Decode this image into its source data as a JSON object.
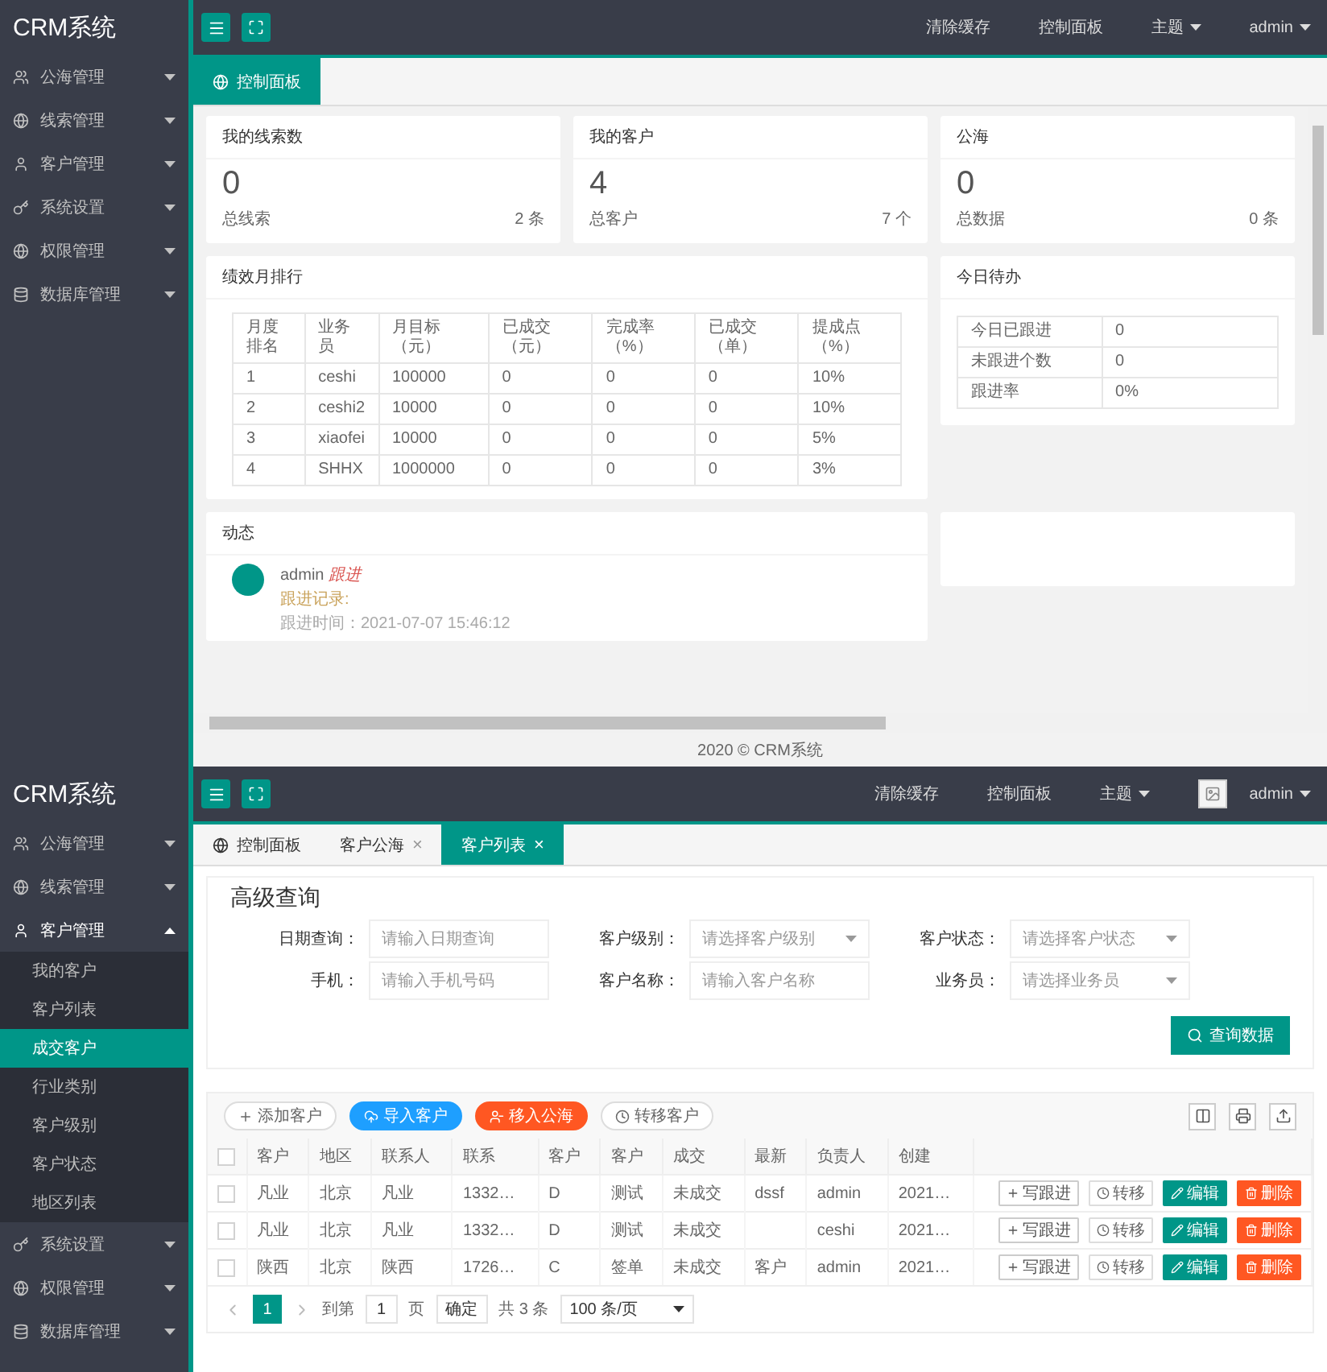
{
  "screens": [
    {
      "header": {
        "logo": "CRM系统",
        "links": [
          {
            "label": "清除缓存",
            "dropdown": false,
            "avatar": false
          },
          {
            "label": "控制面板",
            "dropdown": false,
            "avatar": false
          },
          {
            "label": "主题",
            "dropdown": true,
            "avatar": false
          },
          {
            "label": "admin",
            "dropdown": true,
            "avatar": false
          }
        ]
      },
      "sidebar": [
        {
          "label": "公海管理",
          "expanded": false
        },
        {
          "label": "线索管理",
          "expanded": false
        },
        {
          "label": "客户管理",
          "expanded": false
        },
        {
          "label": "系统设置",
          "expanded": false
        },
        {
          "label": "权限管理",
          "expanded": false
        },
        {
          "label": "数据库管理",
          "expanded": false
        }
      ],
      "tabs": [
        {
          "kind": "home",
          "label": "控制面板",
          "selected": true
        }
      ],
      "stat_cards": [
        {
          "title": "我的线索数",
          "value": "0",
          "footer_label": "总线索",
          "footer_count": "2 条"
        },
        {
          "title": "我的客户",
          "value": "4",
          "footer_label": "总客户",
          "footer_count": "7 个"
        },
        {
          "title": "公海",
          "value": "0",
          "footer_label": "总数据",
          "footer_count": "0 条"
        }
      ],
      "ranking": {
        "title": "绩效月排行",
        "columns": [
          "月度排名",
          "业务员",
          "月目标（元）",
          "已成交（元）",
          "完成率（%）",
          "已成交（单）",
          "提成点（%）"
        ],
        "rows": [
          [
            "1",
            "ceshi",
            "100000",
            "0",
            "0",
            "0",
            "10%"
          ],
          [
            "2",
            "ceshi2",
            "10000",
            "0",
            "0",
            "0",
            "10%"
          ],
          [
            "3",
            "xiaofei",
            "10000",
            "0",
            "0",
            "0",
            "5%"
          ],
          [
            "4",
            "SHHX",
            "1000000",
            "0",
            "0",
            "0",
            "3%"
          ]
        ]
      },
      "todo": {
        "title": "今日待办",
        "rows": [
          [
            "今日已跟进",
            "0"
          ],
          [
            "未跟进个数",
            "0"
          ],
          [
            "跟进率",
            "0%"
          ]
        ]
      },
      "activity": {
        "title": "动态",
        "items": [
          {
            "user": "admin",
            "action": "跟进",
            "note": "跟进记录:",
            "time": "跟进时间：2021-07-07 15:46:12"
          }
        ]
      },
      "footer": "2020 ©  CRM系统"
    },
    {
      "header": {
        "logo": "CRM系统",
        "links": [
          {
            "label": "清除缓存",
            "dropdown": false,
            "avatar": false
          },
          {
            "label": "控制面板",
            "dropdown": false,
            "avatar": false
          },
          {
            "label": "主题",
            "dropdown": true,
            "avatar": false
          },
          {
            "label": "admin",
            "dropdown": true,
            "avatar": true
          }
        ]
      },
      "sidebar": [
        {
          "label": "公海管理",
          "expanded": false
        },
        {
          "label": "线索管理",
          "expanded": false
        },
        {
          "label": "客户管理",
          "expanded": true,
          "children": [
            {
              "label": "我的客户",
              "selected": false
            },
            {
              "label": "客户列表",
              "selected": false
            },
            {
              "label": "成交客户",
              "selected": true
            },
            {
              "label": "行业类别",
              "selected": false
            },
            {
              "label": "客户级别",
              "selected": false
            },
            {
              "label": "客户状态",
              "selected": false
            },
            {
              "label": "地区列表",
              "selected": false
            }
          ]
        },
        {
          "label": "系统设置",
          "expanded": false
        },
        {
          "label": "权限管理",
          "expanded": false
        },
        {
          "label": "数据库管理",
          "expanded": false
        }
      ],
      "tabs": [
        {
          "kind": "home",
          "label": "控制面板",
          "selected": false
        },
        {
          "kind": "page",
          "label": "客户公海",
          "close": "×",
          "selected": false
        },
        {
          "kind": "page",
          "label": "客户列表",
          "close": "×",
          "selected": true
        }
      ],
      "search": {
        "title": "高级查询",
        "fields": [
          {
            "kind": "input",
            "label": "日期查询：",
            "placeholder": "请输入日期查询"
          },
          {
            "kind": "select",
            "label": "客户级别：",
            "placeholder": "请选择客户级别"
          },
          {
            "kind": "select",
            "label": "客户状态：",
            "placeholder": "请选择客户状态"
          },
          {
            "kind": "input",
            "label": "手机：",
            "placeholder": "请输入手机号码"
          },
          {
            "kind": "input",
            "label": "客户名称：",
            "placeholder": "请输入客户名称"
          },
          {
            "kind": "select",
            "label": "业务员：",
            "placeholder": "请选择业务员"
          }
        ],
        "button": "查询数据"
      },
      "toolbar": [
        {
          "kind": "add",
          "label": "添加客户"
        },
        {
          "kind": "import",
          "label": "导入客户"
        },
        {
          "kind": "public",
          "label": "移入公海"
        },
        {
          "kind": "transfer",
          "label": "转移客户"
        }
      ],
      "table": {
        "checked": false,
        "columns": [
          "客户",
          "地区",
          "联系人",
          "联系",
          "客户",
          "客户",
          "成交",
          "最新",
          "负责人",
          "创建"
        ],
        "rows": [
          {
            "checked": false,
            "cells": [
              "凡业",
              "北京",
              "凡业",
              "1332…",
              "D",
              "测试",
              "未成交",
              "dssf",
              "admin",
              "2021…"
            ],
            "actions": [
              {
                "kind": "follow",
                "label": "写跟进"
              },
              {
                "kind": "transfer",
                "label": "转移"
              },
              {
                "kind": "edit",
                "label": "编辑"
              },
              {
                "kind": "delete",
                "label": "删除"
              }
            ]
          },
          {
            "checked": false,
            "cells": [
              "凡业",
              "北京",
              "凡业",
              "1332…",
              "D",
              "测试",
              "未成交",
              "",
              "ceshi",
              "2021…"
            ],
            "actions": [
              {
                "kind": "follow",
                "label": "写跟进"
              },
              {
                "kind": "transfer",
                "label": "转移"
              },
              {
                "kind": "edit",
                "label": "编辑"
              },
              {
                "kind": "delete",
                "label": "删除"
              }
            ]
          },
          {
            "checked": false,
            "cells": [
              "陕西",
              "北京",
              "陕西",
              "1726…",
              "C",
              "签单",
              "未成交",
              "客户",
              "admin",
              "2021…"
            ],
            "actions": [
              {
                "kind": "follow",
                "label": "写跟进"
              },
              {
                "kind": "transfer",
                "label": "转移"
              },
              {
                "kind": "edit",
                "label": "编辑"
              },
              {
                "kind": "delete",
                "label": "删除"
              }
            ]
          }
        ]
      },
      "pagination": {
        "pages": [
          {
            "label": "1",
            "selected": true
          }
        ],
        "goto_label": "到第",
        "page_input": "1",
        "page_unit": "页",
        "confirm": "确定",
        "total": "共 3 条",
        "page_size": "100 条/页"
      }
    }
  ]
}
